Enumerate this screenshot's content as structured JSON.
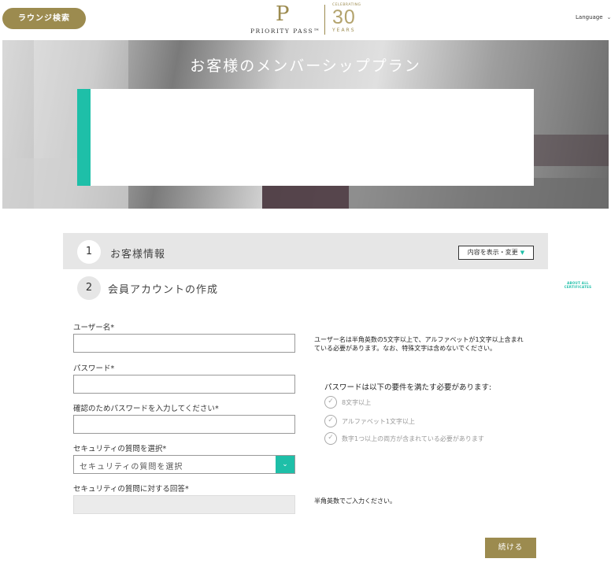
{
  "header": {
    "lounge_search_label": "ラウンジ検索",
    "logo": {
      "mark": "P",
      "name": "PRIORITY PASS™",
      "celebrating": "CELEBRATING",
      "number": "30",
      "years": "YEARS"
    },
    "language_label": "Language",
    "language_chevron": "chevron-down-icon"
  },
  "hero": {
    "title": "お客様のメンバーシッププラン",
    "accent_color": "#1ebfa8"
  },
  "steps": [
    {
      "number": "1",
      "label": "お客様情報",
      "toggle_label": "内容を表示・変更"
    },
    {
      "number": "2",
      "label": "会員アカウントの作成"
    }
  ],
  "about_link": "ABOUT ALL CERTIFICATES",
  "form": {
    "username": {
      "label": "ユーザー名",
      "required_mark": "*",
      "value": ""
    },
    "password": {
      "label": "パスワード",
      "required_mark": "*",
      "value": ""
    },
    "confirm_password": {
      "label": "確認のためパスワードを入力してください",
      "required_mark": "*",
      "value": ""
    },
    "security_question": {
      "label": "セキュリティの質問を選択",
      "required_mark": "*",
      "selected": "セキュリティの質問を選択"
    },
    "security_answer": {
      "label": "セキュリティの質問に対する回答",
      "required_mark": "*",
      "value": ""
    }
  },
  "hints": {
    "username_hint_line1": "ユーザー名は半角英数の5文字以上で、アルファベットが1文字以上含まれ",
    "username_hint_line2": "ている必要があります。なお、特殊文字は含めないでください。",
    "password_requirements_title": "パスワードは以下の要件を満たす必要があります:",
    "password_requirements": [
      "8文字以上",
      "アルファベット1文字以上",
      "数字1つ以上の両方が含まれている必要があります"
    ],
    "answer_hint": "半角英数でご入力ください。"
  },
  "continue_label": "続ける",
  "colors": {
    "gold": "#9c8b4f",
    "teal": "#1ebfa8"
  }
}
